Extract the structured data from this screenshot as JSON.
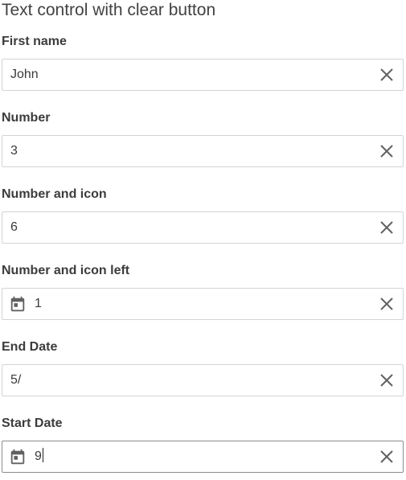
{
  "page": {
    "title": "Text control with clear button"
  },
  "fields": [
    {
      "label": "First name",
      "value": "John",
      "left_icon": null,
      "clear_icon": "close-icon"
    },
    {
      "label": "Number",
      "value": "3",
      "left_icon": null,
      "clear_icon": "close-icon"
    },
    {
      "label": "Number and icon",
      "value": "6",
      "left_icon": null,
      "clear_icon": "close-icon"
    },
    {
      "label": "Number and icon left",
      "value": "1",
      "left_icon": "calendar-icon",
      "clear_icon": "close-icon"
    },
    {
      "label": "End Date",
      "value": "5/",
      "left_icon": null,
      "clear_icon": "close-icon"
    },
    {
      "label": "Start Date",
      "value": "9",
      "left_icon": "calendar-icon",
      "clear_icon": "close-icon",
      "focused": true
    }
  ],
  "colors": {
    "icon": "#616161",
    "border": "#d4d4d4",
    "focused_border": "#8c8c8c"
  }
}
